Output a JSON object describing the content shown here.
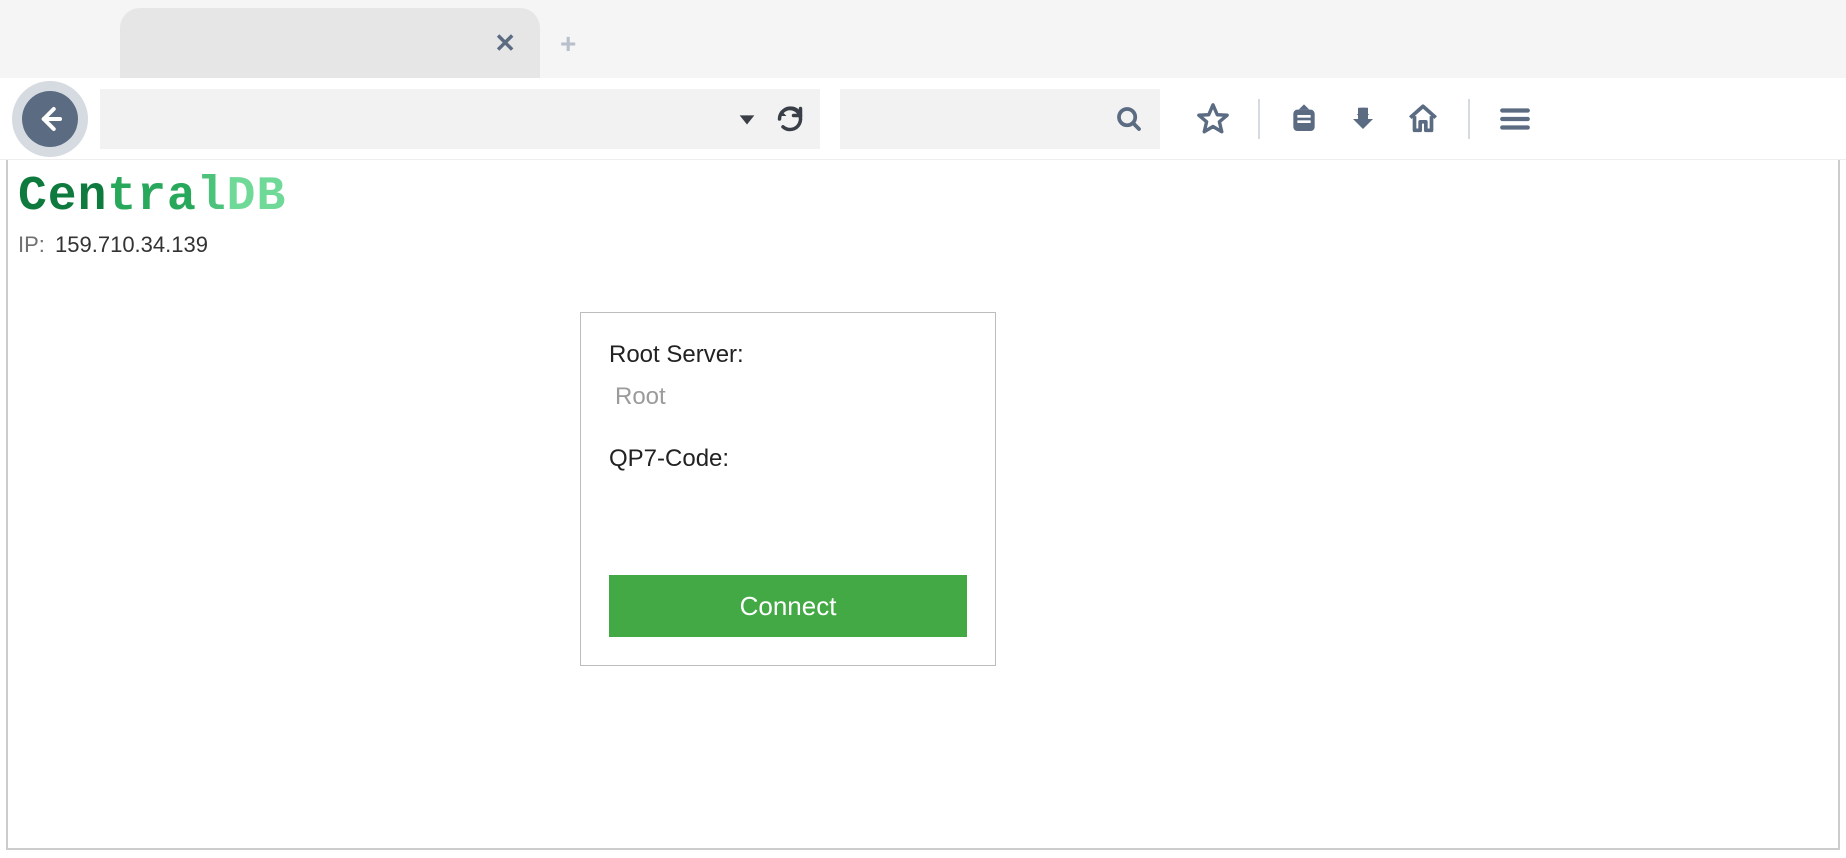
{
  "browser": {
    "tab_close_glyph": "✕",
    "new_tab_glyph": "+"
  },
  "page": {
    "logo_text": "CentralDB",
    "ip_label": "IP:",
    "ip_value": "159.710.34.139"
  },
  "form": {
    "root_label": "Root Server:",
    "root_placeholder": "Root",
    "code_label": "QP7-Code:",
    "connect_label": "Connect"
  }
}
